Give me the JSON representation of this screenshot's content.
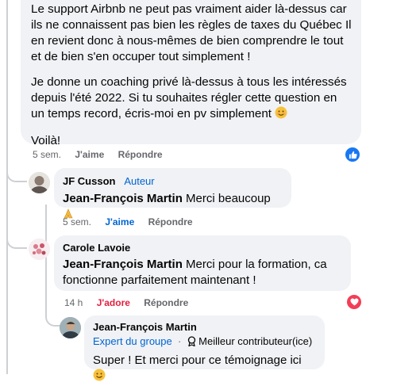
{
  "post": {
    "paragraphs": [
      "Le support Airbnb ne peut pas vraiment aider là-dessus car ils ne connaissent pas bien les règles de taxes du Québec Il en revient donc à nous-mêmes de bien comprendre le tout et de bien s'en occuper tout simplement !",
      "Je donne un coaching privé là-dessus à tous les intéressés depuis l'été 2022. Si tu souhaites régler cette question en un temps record, écris-moi en pv simplement",
      "Voilà!"
    ],
    "time": "5 sem.",
    "like_label": "J'aime",
    "reply_label": "Répondre"
  },
  "reply1": {
    "author": "JF Cusson",
    "badge": "Auteur",
    "mention": "Jean-François Martin",
    "text": "Merci beaucoup",
    "time": "5 sem.",
    "like_label": "J'aime",
    "reply_label": "Répondre"
  },
  "reply2": {
    "author": "Carole Lavoie",
    "mention": "Jean-François Martin",
    "text_line1": "Merci pour la formation, ca",
    "text_line2": "fonctionne parfaitement maintenant !",
    "time": "14 h",
    "love_label": "J'adore",
    "reply_label": "Répondre"
  },
  "reply3": {
    "author": "Jean-François Martin",
    "badge_expert": "Expert du groupe",
    "badge_top": "Meilleur contributeur(ice)",
    "text": "Super ! Et merci pour ce témoignage ici"
  },
  "colors": {
    "bubble": "#f0f2f5",
    "link_blue": "#0064d1",
    "love_red": "#e41e3f",
    "like_blue": "#1877f2"
  }
}
